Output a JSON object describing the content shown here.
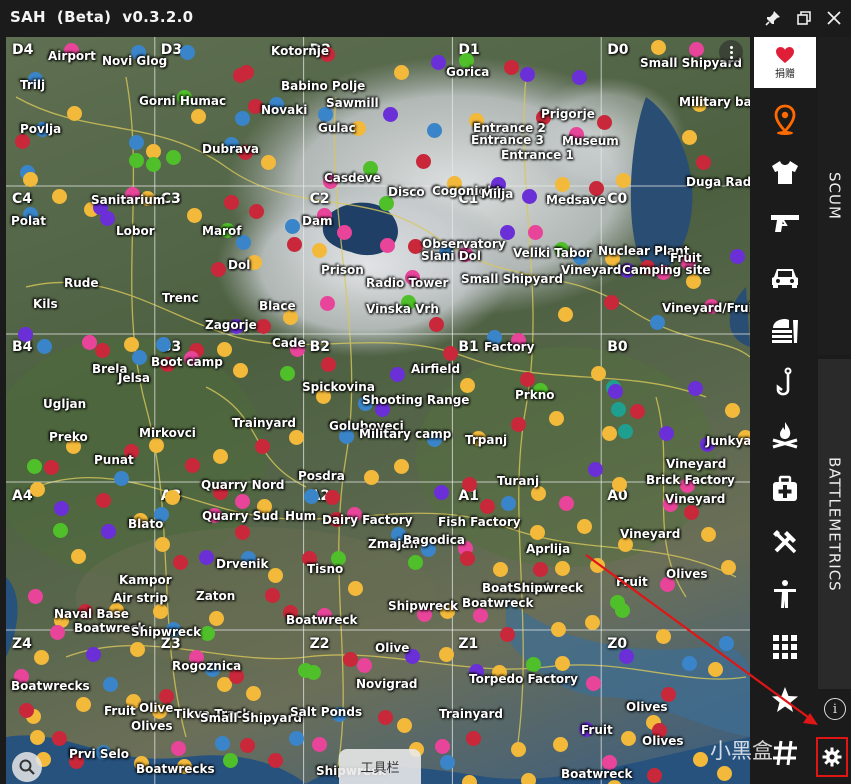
{
  "window": {
    "title": "SAH  (Beta)  v0.3.2.0",
    "controls": [
      "pin-icon",
      "restore-icon",
      "close-icon"
    ]
  },
  "donate": {
    "label": "捐赠",
    "icon": "heart-icon",
    "color": "#e01e37"
  },
  "side_icons": [
    "map-pin-icon",
    "shirt-icon",
    "gun-icon",
    "car-icon",
    "food-icon",
    "fishing-hook-icon",
    "campfire-icon",
    "medkit-icon",
    "tools-icon",
    "person-icon",
    "grid-icon",
    "star-icon",
    "hashtag-icon"
  ],
  "tabs": {
    "scum": "SCUM",
    "battlemetrics": "BATTLEMETRICS"
  },
  "toolbar_label": "工具栏",
  "watermark": "小黑盒",
  "colors": {
    "active_pin": "#ff6a00",
    "highlight": "#e01515"
  },
  "grid_cells": [
    "D4",
    "D3",
    "D2",
    "D1",
    "D0",
    "C4",
    "C3",
    "C2",
    "C1",
    "C0",
    "B4",
    "B3",
    "B2",
    "B1",
    "B0",
    "A4",
    "A3",
    "A2",
    "A1",
    "A0",
    "Z4",
    "Z3",
    "Z2",
    "Z1",
    "Z0"
  ],
  "places": [
    "Airport",
    "Novi Glog",
    "Kotornje",
    "Gorica",
    "Small Shipyard",
    "Trilj",
    "Babino Polje",
    "Military base",
    "Gorni Humac",
    "Novaki",
    "Sawmill",
    "Povlja",
    "Gulac",
    "Prigorje",
    "Dubrava",
    "Entrance 2",
    "Entrance 3",
    "Museum",
    "Entrance 1",
    "Casdeve",
    "Duga Rada",
    "Disco",
    "Cogonight",
    "Milja",
    "Medsave",
    "Polat",
    "Sanitarium",
    "Lobor",
    "Marof",
    "Dam",
    "Observatory",
    "Veliki Tabor",
    "Nuclear Plant",
    "Fruit",
    "Slani Dol",
    "Vineyard",
    "Camping site",
    "Dol",
    "Prison",
    "Radio Tower",
    "Small Shipyard",
    "Rude",
    "Trenc",
    "Blace",
    "Kils",
    "Zagorje",
    "Vinska Vrh",
    "Vineyard/Fruit",
    "Cade",
    "Factory",
    "Brela",
    "Boot camp",
    "Jelsa",
    "Airfield",
    "Spickovina",
    "Prkno",
    "Ugljan",
    "Shooting Range",
    "Goluboveci",
    "Military camp",
    "Preko",
    "Mirkovci",
    "Trainyard",
    "Trpanj",
    "Junkyard",
    "Punat",
    "Vineyard",
    "Brick Factory",
    "Turanj",
    "Quarry Nord",
    "Posdra",
    "Vineyard",
    "Dairy Factory",
    "Fish Factory",
    "Blato",
    "Quarry Sud",
    "Hum",
    "Zmajan",
    "Bagodica",
    "Aprlija",
    "Vineyard",
    "Drvenik",
    "Kampor",
    "Tisno",
    "Boatwreck",
    "Shipwreck",
    "Olives",
    "Fruit",
    "Air strip",
    "Zaton",
    "Boatwreck",
    "Naval Base",
    "Boatwreck",
    "Shipwreck",
    "Boatwreck",
    "Shipwreck",
    "Olive",
    "Rogoznica",
    "Novigrad",
    "Torpedo Factory",
    "Boatwrecks",
    "Fruit",
    "Olive",
    "Tikva Track",
    "Small Shipyard",
    "Salt Ponds",
    "Olives",
    "Trainyard",
    "Olives",
    "Fruit",
    "Olives",
    "Prvi Selo",
    "Boatwrecks",
    "Shipwreck",
    "Boatwreck"
  ]
}
